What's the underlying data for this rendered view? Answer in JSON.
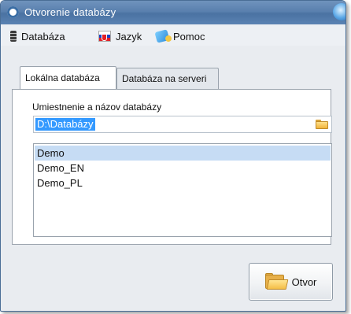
{
  "window": {
    "title": "Otvorenie databázy"
  },
  "menu": {
    "items": [
      {
        "label": "Databáza",
        "icon": "database-icon"
      },
      {
        "label": "Jazyk",
        "icon": "slovak-flag-icon"
      },
      {
        "label": "Pomoc",
        "icon": "help-book-icon"
      }
    ]
  },
  "tabs": [
    {
      "label": "Lokálna databáza",
      "active": true
    },
    {
      "label": "Databáza na serveri",
      "active": false
    }
  ],
  "local": {
    "location_label": "Umiestnenie a názov databázy",
    "path_value": "D:\\Databázy",
    "databases": [
      "Demo",
      "Demo_EN",
      "Demo_PL"
    ],
    "selected": "Demo"
  },
  "actions": {
    "open_label": "Otvor"
  },
  "colors": {
    "titlebar": "#5a80ae",
    "selection": "#3399ff",
    "list_selection": "#c6dcf4"
  }
}
